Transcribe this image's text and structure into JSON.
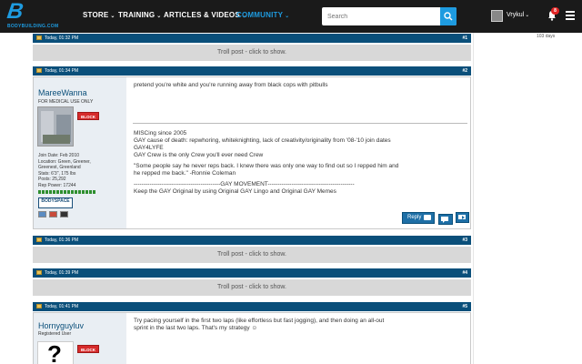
{
  "nav": {
    "logo_letter": "B",
    "logo_text": "BODYBUILDING.COM",
    "items": [
      {
        "label": "STORE",
        "chev": "⌄"
      },
      {
        "label": "TRAINING",
        "chev": "⌄"
      },
      {
        "label": "ARTICLES & VIDEOS",
        "chev": "⌄"
      },
      {
        "label": "COMMUNITY",
        "chev": "⌄"
      }
    ],
    "search_placeholder": "Search",
    "username": "Vrykul",
    "user_chev": "⌄",
    "notification_count": "8"
  },
  "side": {
    "days_text": "103 days"
  },
  "posts": [
    {
      "date": "Today, 01:32 PM",
      "number": "#1",
      "troll_text": "Troll post - click to show."
    },
    {
      "date": "Today, 01:34 PM",
      "number": "#2"
    },
    {
      "date": "Today, 01:36 PM",
      "number": "#3",
      "troll_text": "Troll post - click to show."
    },
    {
      "date": "Today, 01:39 PM",
      "number": "#4",
      "troll_text": "Troll post - click to show."
    },
    {
      "date": "Today, 01:41 PM",
      "number": "#5"
    }
  ],
  "post2": {
    "username": "MareeWanna",
    "user_title": "FOR MEDICAL USE ONLY",
    "block_label": "BLOCK",
    "stats": [
      "Join Date: Feb 2010",
      "Location: Green, Greener,",
      "Greenest, Greenland",
      "Stats: 6'3\", 175 lbs",
      "Posts: 25,292",
      "Rep Power: 17244"
    ],
    "bodyspace_label": "BODYSPACE",
    "message": "pretend you're white and you're running away from black cops with pitbulls",
    "signature": [
      "MISCing since 2005",
      "GAY cause of death: repwhoring, whiteknighting, lack of creativity/originality from '08-'10 join dates",
      "GAY4LYFE",
      "GAY Crew is the only Crew you'll ever need Crew",
      "",
      "\"Some people say he never reps back. I knew there was only one way to find out so I repped him and",
      "he repped me back.\" -Ronnie Coleman",
      "",
      "--------------------------------------------GAY MOVEMENT--------------------------------------------",
      "Keep the GAY Original by using Original GAY Lingo and Original GAY Memes"
    ],
    "reply_label": "Reply"
  },
  "post5": {
    "username": "Hornyguyluv",
    "user_title": "Registered User",
    "block_label": "BLOCK",
    "avatar_glyph": "?",
    "message_lines": [
      "Try pacing yourself in the first two laps (like effortless but fast jogging), and then doing an all-out",
      "sprint in the last two laps. That's my strategy ☺"
    ]
  },
  "colors": {
    "bar": "#0a4f7a",
    "accent": "#1e9be0",
    "troll_bg": "#d8d8d8",
    "block": "#d62b2b"
  }
}
